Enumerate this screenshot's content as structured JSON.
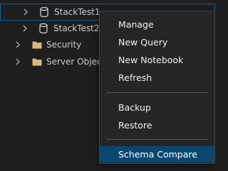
{
  "tree": {
    "items": [
      {
        "label": "StackTest1",
        "icon": "database-icon",
        "expanded": false,
        "selected": true
      },
      {
        "label": "StackTest2",
        "icon": "database-icon",
        "expanded": false,
        "selected": false
      },
      {
        "label": "Security",
        "icon": "folder-icon",
        "expanded": false,
        "selected": false
      },
      {
        "label": "Server Objects",
        "icon": "folder-icon",
        "expanded": false,
        "selected": false
      }
    ]
  },
  "context_menu": {
    "items": [
      {
        "label": "Manage"
      },
      {
        "label": "New Query"
      },
      {
        "label": "New Notebook"
      },
      {
        "label": "Refresh"
      },
      {
        "label": "Backup"
      },
      {
        "label": "Restore"
      },
      {
        "label": "Schema Compare",
        "highlighted": true
      }
    ]
  },
  "colors": {
    "background": "#1e1e1e",
    "menu_background": "#252526",
    "highlight": "#094771",
    "selection_border": "#0e639c",
    "folder": "#dcb67a",
    "text": "#cccccc"
  }
}
